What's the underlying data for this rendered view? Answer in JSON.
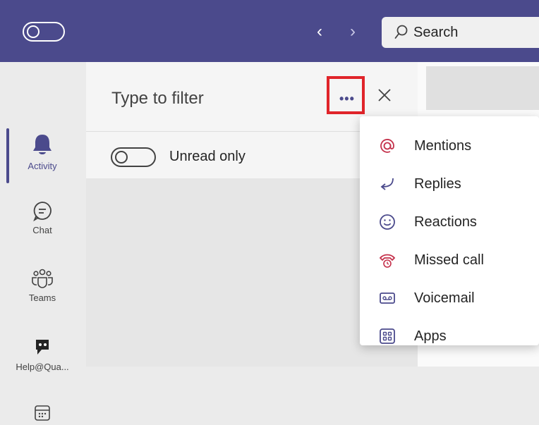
{
  "topbar": {
    "search_placeholder": "Search",
    "back_glyph": "‹",
    "forward_glyph": "›"
  },
  "rail": {
    "items": [
      {
        "label": "Activity",
        "icon": "bell-icon"
      },
      {
        "label": "Chat",
        "icon": "chat-icon"
      },
      {
        "label": "Teams",
        "icon": "teams-icon"
      },
      {
        "label": "Help@Qua...",
        "icon": "help-bot-icon"
      },
      {
        "label": "",
        "icon": "calendar-icon"
      }
    ]
  },
  "filter": {
    "title": "Type to filter",
    "more_glyph": "•••",
    "unread_label": "Unread only"
  },
  "menu": {
    "items": [
      {
        "label": "Mentions",
        "icon": "mention-icon"
      },
      {
        "label": "Replies",
        "icon": "reply-icon"
      },
      {
        "label": "Reactions",
        "icon": "smiley-icon"
      },
      {
        "label": "Missed call",
        "icon": "missed-call-icon"
      },
      {
        "label": "Voicemail",
        "icon": "voicemail-icon"
      },
      {
        "label": "Apps",
        "icon": "apps-icon"
      }
    ]
  },
  "colors": {
    "brand": "#4b4a8c",
    "highlight_box": "#e0242a",
    "missed_call": "#c4314b"
  }
}
